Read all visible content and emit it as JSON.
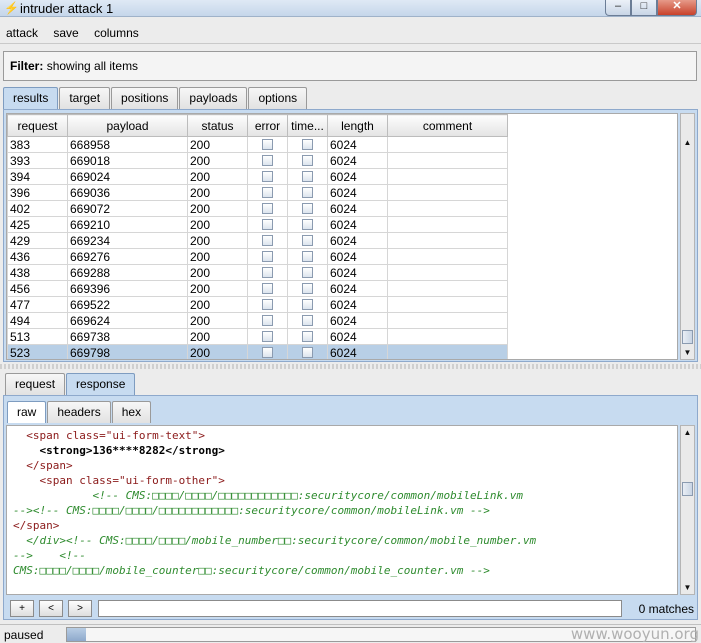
{
  "window": {
    "title": "intruder attack 1",
    "icon": "lightning-icon",
    "buttons": {
      "minimize": "–",
      "maximize": "□",
      "close": "✕"
    }
  },
  "menu": [
    "attack",
    "save",
    "columns"
  ],
  "filter": {
    "label": "Filter:",
    "text": "showing all items"
  },
  "top_tabs": [
    {
      "label": "results",
      "active": true
    },
    {
      "label": "target",
      "active": false
    },
    {
      "label": "positions",
      "active": false
    },
    {
      "label": "payloads",
      "active": false
    },
    {
      "label": "options",
      "active": false
    }
  ],
  "results_table": {
    "columns": [
      "request",
      "payload",
      "status",
      "error",
      "time...",
      "length",
      "comment"
    ],
    "rows": [
      {
        "request": "383",
        "payload": "668958",
        "status": "200",
        "length": "6024"
      },
      {
        "request": "393",
        "payload": "669018",
        "status": "200",
        "length": "6024"
      },
      {
        "request": "394",
        "payload": "669024",
        "status": "200",
        "length": "6024"
      },
      {
        "request": "396",
        "payload": "669036",
        "status": "200",
        "length": "6024"
      },
      {
        "request": "402",
        "payload": "669072",
        "status": "200",
        "length": "6024"
      },
      {
        "request": "425",
        "payload": "669210",
        "status": "200",
        "length": "6024"
      },
      {
        "request": "429",
        "payload": "669234",
        "status": "200",
        "length": "6024"
      },
      {
        "request": "436",
        "payload": "669276",
        "status": "200",
        "length": "6024"
      },
      {
        "request": "438",
        "payload": "669288",
        "status": "200",
        "length": "6024"
      },
      {
        "request": "456",
        "payload": "669396",
        "status": "200",
        "length": "6024"
      },
      {
        "request": "477",
        "payload": "669522",
        "status": "200",
        "length": "6024"
      },
      {
        "request": "494",
        "payload": "669624",
        "status": "200",
        "length": "6024"
      },
      {
        "request": "513",
        "payload": "669738",
        "status": "200",
        "length": "6024"
      },
      {
        "request": "523",
        "payload": "669798",
        "status": "200",
        "length": "6024",
        "selected": true
      }
    ]
  },
  "message_tabs": [
    {
      "label": "request",
      "active": false
    },
    {
      "label": "response",
      "active": true
    }
  ],
  "view_tabs": [
    {
      "label": "raw",
      "active": true
    },
    {
      "label": "headers",
      "active": false
    },
    {
      "label": "hex",
      "active": false
    }
  ],
  "response_lines": [
    "  <span class=\"ui-form-text\">",
    "    <strong>136****8282</strong>",
    "  </span>",
    "    <span class=\"ui-form-other\">",
    "            <!-- CMS:□□□□/□□□□/□□□□□□□□□□□□:securitycore/common/mobileLink.vm",
    "--><!-- CMS:□□□□/□□□□/□□□□□□□□□□□□:securitycore/common/mobileLink.vm -->",
    "</span>",
    "  </div><!-- CMS:□□□□/□□□□/mobile_number□□:securitycore/common/mobile_number.vm",
    "-->    <!--",
    "CMS:□□□□/□□□□/mobile_counter□□:securitycore/common/mobile_counter.vm -->"
  ],
  "search": {
    "prev": "<",
    "next": ">",
    "add": "+",
    "value": "",
    "matches": "0 matches"
  },
  "status": {
    "text": "paused",
    "progress_fraction": 0.03
  },
  "watermark": "www.wooyun.org"
}
